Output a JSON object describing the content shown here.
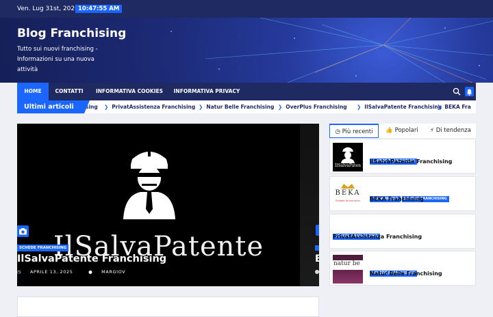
{
  "topbar": {
    "date": "Ven. Lug 31st, 2026",
    "time": "10:47:55 AM"
  },
  "site": {
    "title": "Blog Franchising",
    "description": "Tutto sui nuovi franchising - Informazioni su una nuova attività"
  },
  "nav": {
    "items": [
      "HOME",
      "CONTATTI",
      "INFORMATIVA COOKIES",
      "INFORMATIVA PRIVACY"
    ],
    "icons": [
      "search-icon",
      "bell-icon"
    ]
  },
  "ticker": {
    "label": "Ultimi articoli",
    "items": [
      "sing",
      "PrivatAssistenza Franchising",
      "Natur Belle Franchising",
      "OverPlus Franchising",
      "IlSalvaPatente Franchising",
      "BEKA Fra"
    ]
  },
  "slide": {
    "brand_text": "IlSalvaPatente",
    "category": "SCHEDE FRANCHISING",
    "title": "IlSalvaPatente Franchising",
    "date": "APRILE 13, 2025",
    "author": "MARGIOV",
    "next_title": "B"
  },
  "sidebar": {
    "tabs": [
      "Più recenti",
      "Popolari",
      "Di tendenza"
    ],
    "posts": [
      {
        "cats": [
          "SCHEDE FRANCHISING"
        ],
        "title": "IlSalvaPatente Franchising",
        "thumb_text": "IlSalvaPaten"
      },
      {
        "cats": [
          "FRANCHISING",
          "SCHEDE FRANCHISING"
        ],
        "title": "BEKA Franchising",
        "thumb_text": "BEKA",
        "thumb_sub": "Prodotti Ricostruttivi"
      },
      {
        "cats": [
          "SCHEDE FRANCHISING"
        ],
        "title": "PrivatAssistenza Franchising"
      },
      {
        "cats": [
          "SCHEDE FRANCHISING"
        ],
        "title": "Natur Belle Franchising",
        "thumb_text": "natur be"
      }
    ]
  },
  "colors": {
    "navy": "#1f2a63",
    "accent": "#1a66ff"
  }
}
